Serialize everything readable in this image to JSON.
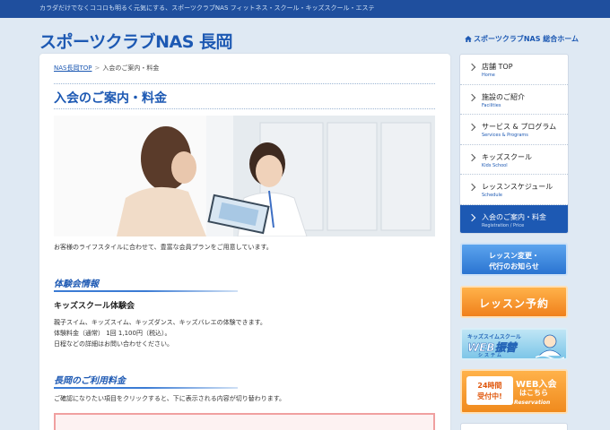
{
  "header": {
    "tagline": "カラダだけでなくココロも明るく元気にする、スポーツクラブNAS フィットネス・スクール・キッズスクール・エステ",
    "site_title": "スポーツクラブNAS 長岡",
    "home_link": "スポーツクラブNAS 総合ホーム"
  },
  "breadcrumb": {
    "home": "NAS長岡TOP",
    "separator": ">",
    "current": "入会のご案内・料金"
  },
  "main": {
    "page_title": "入会のご案内・料金",
    "intro": "お客様のライフスタイルに合わせて、豊富な会員プランをご用意しています。",
    "trial_section": {
      "title": "体験会情報",
      "subtitle": "キッズスクール体験会",
      "lines": [
        "親子スイム、キッズスイム、キッズダンス、キッズバレエの体験できます。",
        "体験料金（通常） 1回 1,100円（税込）。",
        "日程などの詳細はお問い合わせください。"
      ]
    },
    "fee_section": {
      "title": "長岡のご利用料金",
      "instruction": "ご確認になりたい項目をクリックすると、下に表示される内容が切り替わります。"
    }
  },
  "sidebar": {
    "items": [
      {
        "label": "店舗 TOP",
        "sub": "Home",
        "active": false
      },
      {
        "label": "施設のご紹介",
        "sub": "Facilities",
        "active": false
      },
      {
        "label": "サービス & プログラム",
        "sub": "Services & Programs",
        "active": false
      },
      {
        "label": "キッズスクール",
        "sub": "Kids School",
        "active": false
      },
      {
        "label": "レッスンスケジュール",
        "sub": "Schedule",
        "active": false
      },
      {
        "label": "入会のご案内・料金",
        "sub": "Registration / Price",
        "active": true
      }
    ]
  },
  "banners": {
    "lesson_change": {
      "line1": "レッスン変更・",
      "line2": "代行のお知らせ"
    },
    "lesson_booking": "レッスン予約",
    "web_transfer": {
      "line1": "キッズスイムスクール",
      "line2": "WEB振替",
      "line3": "システム"
    },
    "web_join": {
      "badge1": "24時間",
      "badge2": "受付中!",
      "line1": "WEB入会",
      "line2": "はこちら",
      "line3": "Reservation"
    }
  },
  "colors": {
    "brand_blue": "#1d59b3",
    "top_bar": "#1f4f9e",
    "page_bg": "#dfe9f3",
    "orange": "#f0801b"
  }
}
